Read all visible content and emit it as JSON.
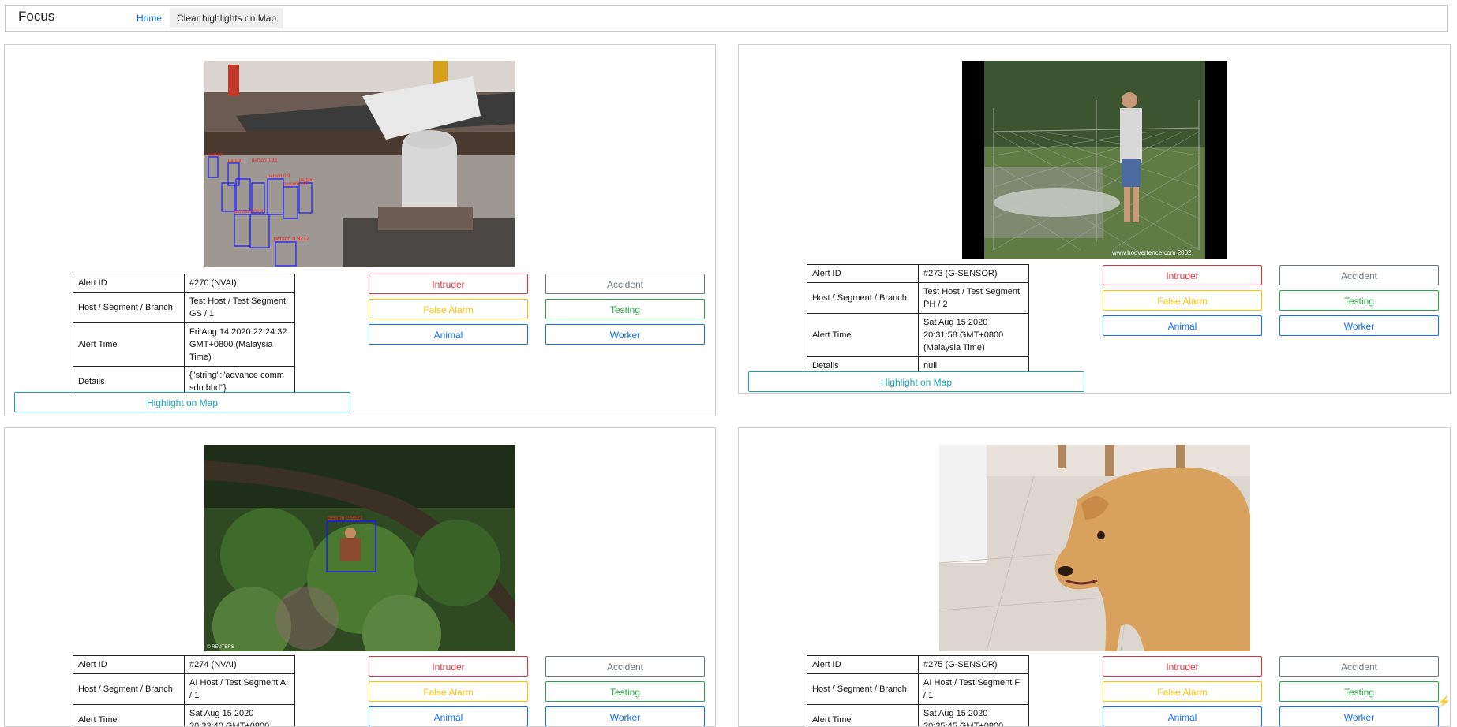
{
  "app": {
    "brand": "Focus"
  },
  "nav": {
    "home": "Home",
    "clear": "Clear highlights on Map"
  },
  "labels": {
    "alert_id": "Alert ID",
    "host": "Host / Segment / Branch",
    "alert_time": "Alert Time",
    "details": "Details"
  },
  "buttons": {
    "intruder": "Intruder",
    "accident": "Accident",
    "false_alarm": "False Alarm",
    "testing": "Testing",
    "animal": "Animal",
    "worker": "Worker",
    "highlight": "Highlight on Map"
  },
  "alerts": [
    {
      "id": "#270 (NVAI)",
      "host": "Test Host / Test Segment GS / 1",
      "time": "Fri Aug 14 2020 22:24:32 GMT+0800 (Malaysia Time)",
      "details": "{\"string\":\"advance comm sdn bhd\"}",
      "detections": [
        {
          "label": "person 0.9212"
        }
      ]
    },
    {
      "id": "#273 (G-SENSOR)",
      "host": "Test Host / Test Segment PH / 2",
      "time": "Sat Aug 15 2020 20:31:58 GMT+0800 (Malaysia Time)",
      "details": "null",
      "watermark": "www.hooverfence.com 2002"
    },
    {
      "id": "#274 (NVAI)",
      "host": "AI Host / Test Segment AI / 1",
      "time": "Sat Aug 15 2020 20:33:40 GMT+0800",
      "detections": [
        {
          "label": "person 0.9621"
        }
      ],
      "credit": "© REUTERS"
    },
    {
      "id": "#275 (G-SENSOR)",
      "host": "AI Host / Test Segment F / 1",
      "time": "Sat Aug 15 2020 20:35:45 GMT+0800"
    }
  ],
  "colors": {
    "intruder": "#dc3545",
    "accident": "#6c757d",
    "false_alarm": "#ffc107",
    "testing": "#28a745",
    "animal": "#0d6efd",
    "highlight": "#17a2b8"
  }
}
